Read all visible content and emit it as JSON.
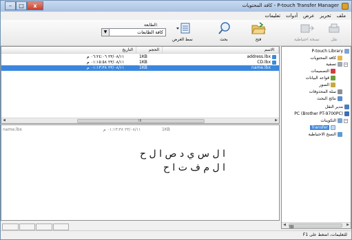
{
  "window": {
    "title": "P-touch Transfer Manager - كافة المحتويات",
    "buttons": {
      "close": "x",
      "maximize": "□",
      "minimize": "–"
    }
  },
  "menu": [
    "ملف",
    "تحرير",
    "عرض",
    "أدوات",
    "تعليمات"
  ],
  "toolbar": {
    "transfer": "نقل",
    "backup": "نسخة احتياطية",
    "open": "فتح",
    "search": "بحث",
    "display_style": "نمط العرض",
    "printer_label": "الطابعة:",
    "printer_value": "كافة الطابعات"
  },
  "list": {
    "columns": {
      "name": "الاسم",
      "size": "الحجم",
      "date": "التاريخ"
    },
    "rows": [
      {
        "name": "address.lbx",
        "size": "1KB",
        "date": "٢٣/٠٨/١١ ٠٦:٢٤:٠٦ م",
        "selected": false
      },
      {
        "name": "CD.lbx",
        "size": "1KB",
        "date": "٢٣/٠٨/١١ ٠١:١٥:٥٨ م",
        "selected": false
      },
      {
        "name": "name.lbx",
        "size": "1KB",
        "date": "٢٣/٠٨/١١ ٠١:١٣:٣٨ م",
        "selected": true
      }
    ],
    "scroll_grip": "III"
  },
  "preview": {
    "filename": "name.lbx",
    "date": "٢٣/٠٨/١١ ٠١:١٣:٣٨ م",
    "size": "1KB",
    "line1": "ا ل س ي د ص ا ل ح",
    "line2": "ا ل م ف ت ا ح"
  },
  "tree": {
    "library": "P-touch Library",
    "all_contents": "كافة المحتويات",
    "filter": "تصفية",
    "layouts": "التصميمات",
    "databases": "قواعد البيانات",
    "images": "الصور",
    "recycle": "سلة المحذوفات",
    "search_results": "نتائج البحث",
    "transfer_manager": "مدير النقل",
    "pc": "(PC (Brother PT-9700PC",
    "configurations": "التكوينات",
    "transfer": "Transfer",
    "backups": "النسخ الاحتياطية",
    "scroll_grip": "III"
  },
  "status": {
    "help": "للتعليمات، اضغط على F1"
  },
  "colors": {
    "selection": "#3a86dd",
    "title_bar": "#b4cbe8"
  }
}
